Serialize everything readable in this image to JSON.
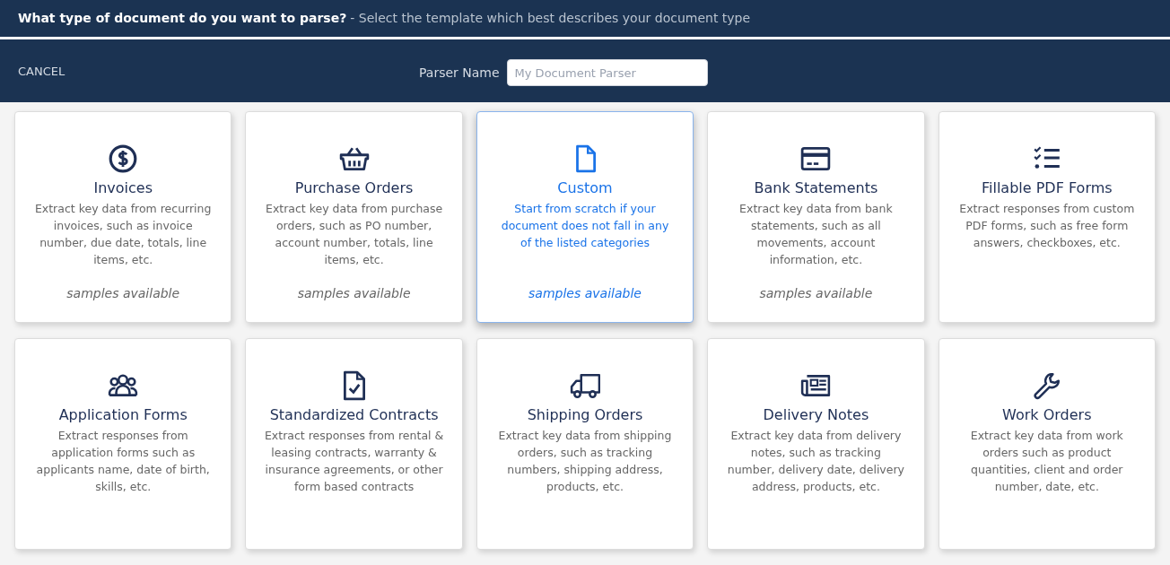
{
  "header": {
    "question": "What type of document do you want to parse?",
    "hint": "- Select the template which best describes your document type"
  },
  "toolbar": {
    "cancel": "CANCEL",
    "parser_name_label": "Parser Name",
    "parser_name": {
      "placeholder": "My Document Parser"
    }
  },
  "templates": [
    {
      "kind": "dollar",
      "title": "Invoices",
      "description": "Extract key data from recurring invoices, such as invoice number, due date, totals, line items, etc.",
      "samples": "samples available",
      "selected": false
    },
    {
      "kind": "basket",
      "title": "Purchase Orders",
      "description": "Extract key data from purchase orders, such as PO number, account number, totals, line items, etc.",
      "samples": "samples available",
      "selected": false
    },
    {
      "kind": "file",
      "title": "Custom",
      "description": "Start from scratch if your document does not fall in any of the listed categories",
      "samples": "samples available",
      "selected": true
    },
    {
      "kind": "card",
      "title": "Bank Statements",
      "description": "Extract key data from bank statements, such as all movements, account information, etc.",
      "samples": "samples available",
      "selected": false
    },
    {
      "kind": "checklist",
      "title": "Fillable PDF Forms",
      "description": "Extract responses from custom PDF forms, such as free form answers, checkboxes, etc.",
      "selected": false
    },
    {
      "kind": "people",
      "title": "Application Forms",
      "description": "Extract responses from application forms such as applicants name, date of birth, skills, etc.",
      "selected": false
    },
    {
      "kind": "filecheck",
      "title": "Standardized Contracts",
      "description": "Extract responses from rental & leasing contracts, warranty & insurance agreements, or other form based contracts",
      "selected": false
    },
    {
      "kind": "truck",
      "title": "Shipping Orders",
      "description": "Extract key data from shipping orders, such as tracking numbers, shipping address, products, etc.",
      "selected": false
    },
    {
      "kind": "newspaper",
      "title": "Delivery Notes",
      "description": "Extract key data from delivery notes, such as tracking number, delivery date, delivery address, products, etc.",
      "selected": false
    },
    {
      "kind": "wrench",
      "title": "Work Orders",
      "description": "Extract key data from work orders such as product quantities, client and order number, date, etc.",
      "selected": false
    }
  ]
}
